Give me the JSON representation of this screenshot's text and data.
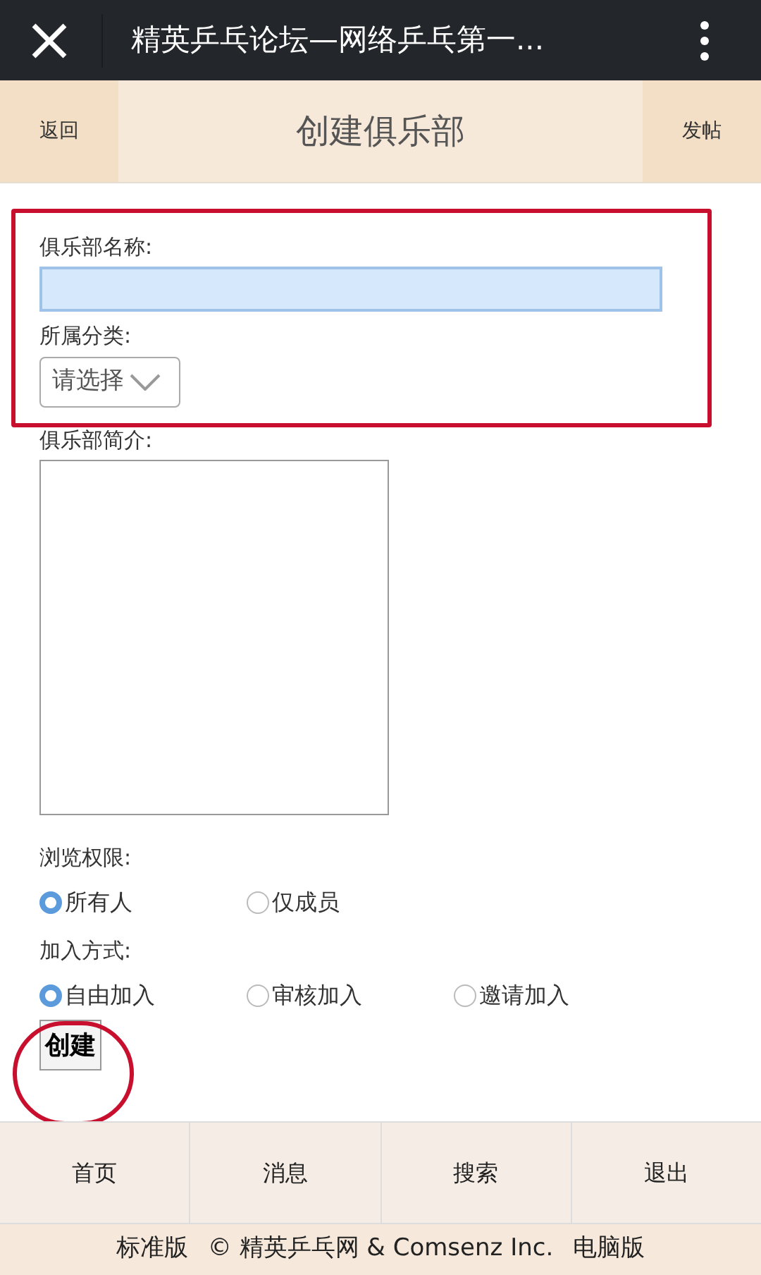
{
  "window": {
    "title": "精英乒乓论坛—网络乒乓第一..."
  },
  "header": {
    "back": "返回",
    "title": "创建俱乐部",
    "post": "发帖"
  },
  "form": {
    "name_label": "俱乐部名称:",
    "category_label": "所属分类:",
    "category_value": "请选择",
    "intro_label": "俱乐部简介:",
    "view_label": "浏览权限:",
    "view_options": [
      {
        "label": "所有人",
        "selected": true
      },
      {
        "label": "仅成员",
        "selected": false
      }
    ],
    "join_label": "加入方式:",
    "join_options": [
      {
        "label": "自由加入",
        "selected": true
      },
      {
        "label": "审核加入",
        "selected": false
      },
      {
        "label": "邀请加入",
        "selected": false
      }
    ],
    "submit": "创建"
  },
  "annotations": {
    "highlight_box": true,
    "highlight_circle": true
  },
  "bottom_nav": [
    "首页",
    "消息",
    "搜索",
    "退出"
  ],
  "footer": {
    "left": "标准版",
    "copyright": "© 精英乒乓网 & Comsenz Inc.",
    "right": "电脑版"
  }
}
